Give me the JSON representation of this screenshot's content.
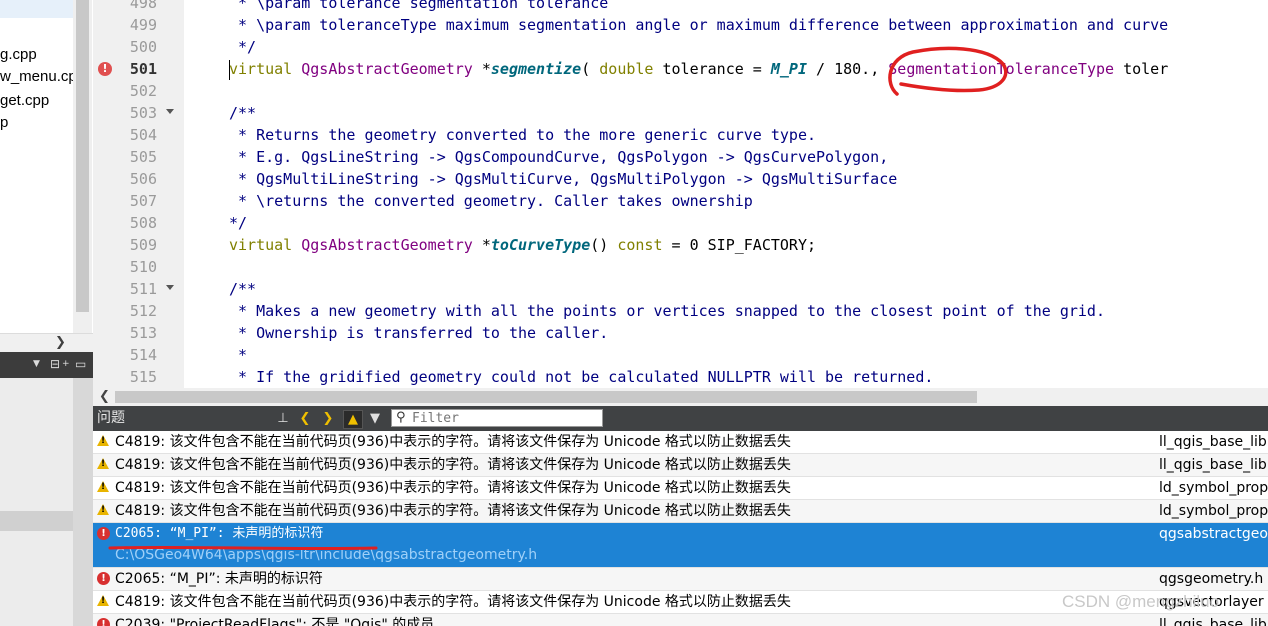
{
  "project_tree": {
    "files": [
      "g.cpp",
      "w_menu.cp",
      "get.cpp",
      "p"
    ]
  },
  "left_toolbar": {
    "split_icon": "split-icon",
    "close_icon": "close-icon"
  },
  "editor": {
    "lines": [
      {
        "num": "498",
        "code": " * \\param tolerance segmentation tolerance"
      },
      {
        "num": "499",
        "code": " * \\param toleranceType maximum segmentation angle or maximum difference between approximation and curve"
      },
      {
        "num": "500",
        "code": " */"
      },
      {
        "num": "501",
        "pre_kw": "virtual",
        "type": "QgsAbstractGeometry",
        "star": " *",
        "fn": "segmentize",
        "p1": "( ",
        "kw2": "double",
        "p2": " tolerance = ",
        "mac": "M_PI",
        "p3": " / 180., ",
        "type2": "SegmentationToleranceType",
        "p4": " toler"
      },
      {
        "num": "502",
        "code": ""
      },
      {
        "num": "503",
        "code": "/**"
      },
      {
        "num": "504",
        "code": " * Returns the geometry converted to the more generic curve type."
      },
      {
        "num": "505",
        "code": " * E.g. QgsLineString -> QgsCompoundCurve, QgsPolygon -> QgsCurvePolygon,"
      },
      {
        "num": "506",
        "code": " * QgsMultiLineString -> QgsMultiCurve, QgsMultiPolygon -> QgsMultiSurface"
      },
      {
        "num": "507",
        "code": " * \\returns the converted geometry. Caller takes ownership"
      },
      {
        "num": "508",
        "code": "*/"
      },
      {
        "num": "509",
        "pre_kw": "virtual",
        "type": "QgsAbstractGeometry",
        "star": " *",
        "fn": "toCurveType",
        "p1": "() ",
        "kw2": "const",
        "p2": " = 0 SIP_FACTORY;"
      },
      {
        "num": "510",
        "code": ""
      },
      {
        "num": "511",
        "code": "/**"
      },
      {
        "num": "512",
        "code": " * Makes a new geometry with all the points or vertices snapped to the closest point of the grid."
      },
      {
        "num": "513",
        "code": " * Ownership is transferred to the caller."
      },
      {
        "num": "514",
        "code": " *"
      },
      {
        "num": "515",
        "code": " * If the gridified geometry could not be calculated NULLPTR will be returned."
      }
    ]
  },
  "issues_panel": {
    "title": "问题",
    "filter_placeholder": "Filter",
    "items": [
      {
        "kind": "warning",
        "message": "C4819: 该文件包含不能在当前代码页(936)中表示的字符。请将该文件保存为 Unicode 格式以防止数据丢失",
        "file": "ll_qgis_base_lib"
      },
      {
        "kind": "warning",
        "message": "C4819: 该文件包含不能在当前代码页(936)中表示的字符。请将该文件保存为 Unicode 格式以防止数据丢失",
        "file": "ll_qgis_base_lib"
      },
      {
        "kind": "warning",
        "message": "C4819: 该文件包含不能在当前代码页(936)中表示的字符。请将该文件保存为 Unicode 格式以防止数据丢失",
        "file": "ld_symbol_prop"
      },
      {
        "kind": "warning",
        "message": "C4819: 该文件包含不能在当前代码页(936)中表示的字符。请将该文件保存为 Unicode 格式以防止数据丢失",
        "file": "ld_symbol_prop"
      },
      {
        "kind": "error",
        "message": "C2065: “M_PI”: 未声明的标识符",
        "path": "C:\\OSGeo4W64\\apps\\qgis-ltr\\include\\qgsabstractgeometry.h",
        "file": "qgsabstractgeo",
        "selected": true
      },
      {
        "kind": "error",
        "message": "C2065: “M_PI”: 未声明的标识符",
        "file": "qgsgeometry.h"
      },
      {
        "kind": "warning",
        "message": "C4819: 该文件包含不能在当前代码页(936)中表示的字符。请将该文件保存为 Unicode 格式以防止数据丢失",
        "file": "qgsvectorlayer"
      },
      {
        "kind": "error",
        "message": "C2039: \"ProjectReadFlags\": 不是 \"Qgis\" 的成员",
        "file": "ll_qgis_base_lib"
      }
    ]
  },
  "watermark": "CSDN @mengzhiluo",
  "colors": {
    "selection": "#1e83d4",
    "annotation": "#e02020",
    "error": "#d83030",
    "warning": "#e8b400"
  }
}
